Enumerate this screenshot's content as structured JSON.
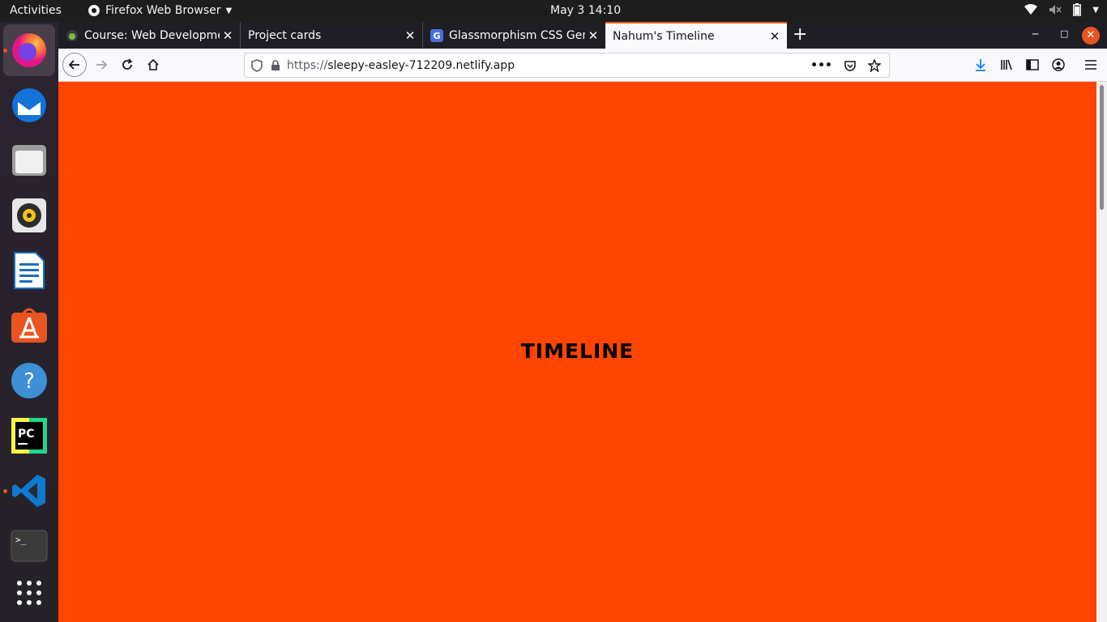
{
  "topbar": {
    "activities": "Activities",
    "app_menu": "Firefox Web Browser",
    "clock": "May 3  14:10"
  },
  "dock": {
    "apps": [
      {
        "name": "firefox-icon",
        "color": "#ff7139",
        "active": true,
        "running": true
      },
      {
        "name": "thunderbird-icon",
        "color": "#0a84ff",
        "active": false,
        "running": false
      },
      {
        "name": "files-icon",
        "color": "#d6d6d6",
        "active": false,
        "running": false
      },
      {
        "name": "rhythmbox-icon",
        "color": "#f0c419",
        "active": false,
        "running": false
      },
      {
        "name": "libreoffice-writer-icon",
        "color": "#1e6fba",
        "active": false,
        "running": false
      },
      {
        "name": "app-center-icon",
        "color": "#e95420",
        "active": false,
        "running": false
      },
      {
        "name": "help-icon",
        "color": "#3d8fd6",
        "active": false,
        "running": false
      },
      {
        "name": "pycharm-icon",
        "color": "#21d789",
        "active": false,
        "running": false
      },
      {
        "name": "vscode-icon",
        "color": "#0e7ad3",
        "active": false,
        "running": true
      },
      {
        "name": "terminal-icon",
        "color": "#3a3a3a",
        "active": false,
        "running": false
      }
    ],
    "show_apps": "show-applications-icon"
  },
  "tabs": [
    {
      "title": "Course: Web Development",
      "favicon": "course-favicon"
    },
    {
      "title": "Project cards",
      "favicon": ""
    },
    {
      "title": "Glassmorphism CSS Generator",
      "favicon": "glassmorphism-favicon"
    },
    {
      "title": "Nahum's Timeline",
      "favicon": ""
    }
  ],
  "urlbar": {
    "protocol": "https://",
    "host": "sleepy-easley-712209.netlify.app"
  },
  "page": {
    "heading": "TIMELINE",
    "background": "#ff4500"
  },
  "colors": {
    "accent": "#e66000",
    "ubuntu_orange": "#e95420"
  }
}
